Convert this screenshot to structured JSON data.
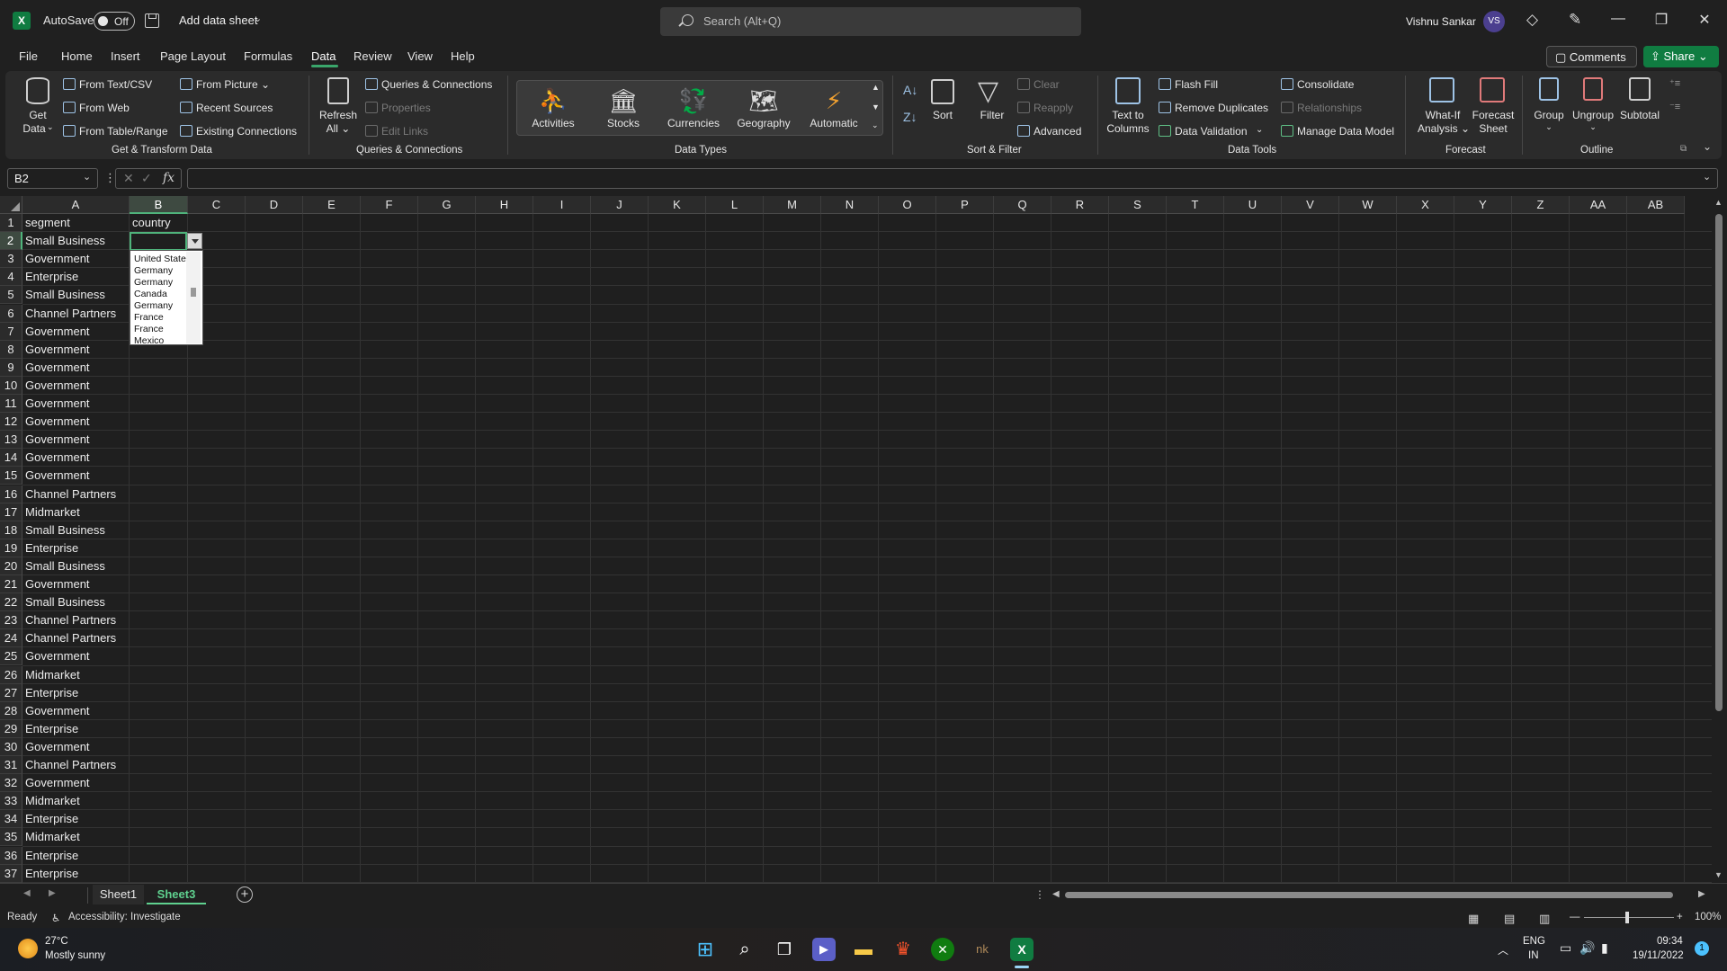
{
  "titlebar": {
    "app_icon": "X",
    "autosave_label": "AutoSave",
    "autosave_state": "Off",
    "doc_title": "Add data sheet",
    "search_placeholder": "Search (Alt+Q)",
    "user_name": "Vishnu Sankar",
    "user_initials": "VS"
  },
  "menu": {
    "tabs": [
      "File",
      "Home",
      "Insert",
      "Page Layout",
      "Formulas",
      "Data",
      "Review",
      "View",
      "Help"
    ],
    "active_tab": "Data",
    "comments_label": "Comments",
    "share_label": "Share"
  },
  "ribbon": {
    "get_transform": {
      "get_data": "Get",
      "get_data2": "Data",
      "from_text_csv": "From Text/CSV",
      "from_web": "From Web",
      "from_table_range": "From Table/Range",
      "from_picture": "From Picture",
      "recent_sources": "Recent Sources",
      "existing_connections": "Existing Connections",
      "group_label": "Get & Transform Data"
    },
    "queries": {
      "refresh_all": "Refresh",
      "refresh_all2": "All",
      "queries_connections": "Queries & Connections",
      "properties": "Properties",
      "edit_links": "Edit Links",
      "group_label": "Queries & Connections"
    },
    "data_types": {
      "items": [
        "Activities",
        "Stocks",
        "Currencies",
        "Geography",
        "Automatic"
      ],
      "group_label": "Data Types"
    },
    "sort_filter": {
      "sort": "Sort",
      "filter": "Filter",
      "clear": "Clear",
      "reapply": "Reapply",
      "advanced": "Advanced",
      "group_label": "Sort & Filter"
    },
    "data_tools": {
      "text_to_columns": "Text to",
      "text_to_columns2": "Columns",
      "flash_fill": "Flash Fill",
      "remove_duplicates": "Remove Duplicates",
      "data_validation": "Data Validation",
      "consolidate": "Consolidate",
      "relationships": "Relationships",
      "manage_data_model": "Manage Data Model",
      "group_label": "Data Tools"
    },
    "forecast": {
      "what_if": "What-If",
      "what_if2": "Analysis",
      "forecast_sheet": "Forecast",
      "forecast_sheet2": "Sheet",
      "group_label": "Forecast"
    },
    "outline": {
      "group": "Group",
      "ungroup": "Ungroup",
      "subtotal": "Subtotal",
      "group_label": "Outline"
    }
  },
  "formula_bar": {
    "name_box": "B2",
    "fx": "fx",
    "value": ""
  },
  "grid": {
    "columns": [
      "A",
      "B",
      "C",
      "D",
      "E",
      "F",
      "G",
      "H",
      "I",
      "J",
      "K",
      "L",
      "M",
      "N",
      "O",
      "P",
      "Q",
      "R",
      "S",
      "T",
      "U",
      "V",
      "W",
      "X",
      "Y",
      "Z",
      "AA",
      "AB"
    ],
    "rows": [
      "1",
      "2",
      "3",
      "4",
      "5",
      "6",
      "7",
      "8",
      "9",
      "10",
      "11",
      "12",
      "13",
      "14",
      "15",
      "16",
      "17",
      "18",
      "19",
      "20",
      "21",
      "22",
      "23",
      "24",
      "25",
      "26",
      "27",
      "28",
      "29",
      "30",
      "31",
      "32",
      "33",
      "34",
      "35",
      "36",
      "37"
    ],
    "col_a": [
      "segment",
      "Small Business",
      "Government",
      "Enterprise",
      "Small Business",
      "Channel Partners",
      "Government",
      "Government",
      "Government",
      "Government",
      "Government",
      "Government",
      "Government",
      "Government",
      "Government",
      "Channel Partners",
      "Midmarket",
      "Small Business",
      "Enterprise",
      "Small Business",
      "Government",
      "Small Business",
      "Channel Partners",
      "Channel Partners",
      "Government",
      "Midmarket",
      "Enterprise",
      "Government",
      "Enterprise",
      "Government",
      "Channel Partners",
      "Government",
      "Midmarket",
      "Enterprise",
      "Midmarket",
      "Enterprise",
      "Enterprise"
    ],
    "b1": "country",
    "selected_cell": "B2"
  },
  "dropdown": {
    "options": [
      "United States",
      "Germany",
      "Germany",
      "Canada",
      "Germany",
      "France",
      "France",
      "Mexico"
    ]
  },
  "sheets": {
    "tabs": [
      "Sheet1",
      "Sheet3"
    ],
    "active": "Sheet3"
  },
  "status": {
    "ready": "Ready",
    "accessibility": "Accessibility: Investigate",
    "zoom": "100%"
  },
  "taskbar": {
    "temperature": "27°C",
    "weather": "Mostly sunny",
    "lang1": "ENG",
    "lang2": "IN",
    "time": "09:34",
    "date": "19/11/2022",
    "notification_count": "1"
  },
  "colors": {
    "accent_green": "#107c41",
    "selection_green": "#4fb37b",
    "background": "#1f1f1f",
    "ribbon": "#2b2b2b"
  }
}
